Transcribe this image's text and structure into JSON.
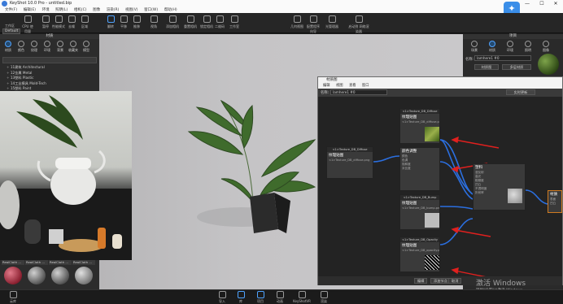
{
  "app": {
    "title": "KeyShot 10.0 Pro - untitled.bip"
  },
  "window_controls": [
    "—",
    "☐",
    "✕"
  ],
  "menu": [
    "文件(F)",
    "编辑(E)",
    "环境",
    "照明(L)",
    "相机(C)",
    "图像",
    "渲染(R)",
    "视图(V)",
    "窗口(W)",
    "帮助(H)"
  ],
  "toolbar": {
    "workspace": "Default",
    "items": [
      "工作区",
      "CPU 使用量",
      "暂停",
      "性能模式",
      "去噪",
      "区域",
      "翻转",
      "平移",
      "推移",
      "视角",
      "添加相机",
      "重置相机",
      "锁定相机",
      "二维码",
      "工作室",
      "几何视图",
      "配置程序向导",
      "光管理器",
      "启动到 网络渲染器"
    ]
  },
  "left_panel": {
    "header": "材质",
    "tabs": [
      "材质",
      "颜色",
      "纹理",
      "环境",
      "背景",
      "收藏夹",
      "模型"
    ],
    "tree": [
      "11建筑 Architectural",
      "12金属 Metal",
      "13塑料 Plastic",
      "14工业模具 Mold-Tech",
      "15塑料 Paint"
    ],
    "thumbs": [
      "RealCloth ...",
      "RealCloth ...",
      "RealCloth ...",
      "RealCloth ..."
    ]
  },
  "right_panel": {
    "header": "项目",
    "tabs": [
      "场景",
      "材质",
      "环境",
      "照明",
      "图像"
    ],
    "name_label": "名称:",
    "name_value": "Iamhere1 #0",
    "btn1": "材质图",
    "btn2": "多层材质"
  },
  "graph": {
    "title": "材质图",
    "menu": [
      "编辑",
      "视图",
      "查看",
      "窗口"
    ],
    "name_label": "名称:",
    "name_value": "Iamhere1 #0",
    "live_update": "实时更新",
    "nodes": {
      "diffuse": {
        "hdr": "<1>Texture_DB_Diffuse",
        "title": "纹理贴图",
        "file": "<1>Texture_DB_diffuse.png"
      },
      "adjust": {
        "hdr": "",
        "title": "颜色调整",
        "props": [
          "颜色",
          "色调",
          "饱和度",
          "对比度"
        ]
      },
      "base": {
        "hdr": "<1>Texture_DB_Diffuse",
        "title": "纹理贴图",
        "file": "<1>Texture_DB_diffuse.png"
      },
      "bump": {
        "hdr": "<1>Texture_DB_Bump",
        "title": "纹理贴图",
        "file": "<1>Texture_DB_bump.png"
      },
      "opacity": {
        "hdr": "<1>Texture_DB_Opacity",
        "title": "纹理贴图",
        "file": "<1>Texture_DB_opacity.png"
      },
      "material": {
        "title": "塑料",
        "props": [
          "漫反射",
          "高光",
          "粗糙度",
          "凹凸",
          "不透明度",
          "折射率"
        ]
      },
      "output": {
        "title": "材质",
        "props": [
          "表面",
          "凹凸",
          "标签"
        ]
      }
    },
    "bottom_buttons": [
      "编辑",
      "添加节点",
      "取消"
    ]
  },
  "bottom_bar": {
    "items": [
      "导入",
      "库",
      "项目",
      "动画",
      "KeyShotVR",
      "渲染"
    ],
    "left": "云库"
  },
  "watermark": {
    "line1": "激活 Windows",
    "line2": "转到\"设置\"以激活 Windows。"
  },
  "colors": {
    "accent": "#4fa3ff",
    "link": "#2b6fe0",
    "arrow": "#e0201e",
    "logo": "#3a8ee8"
  }
}
